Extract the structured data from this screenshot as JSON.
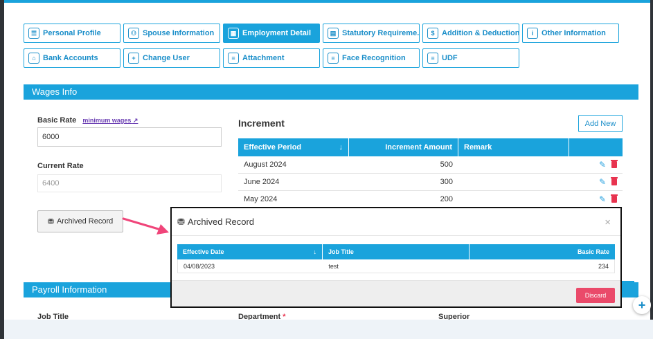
{
  "tabs": [
    {
      "label": "Personal Profile",
      "icon": "profile-icon",
      "active": false
    },
    {
      "label": "Spouse Information",
      "icon": "spouse-icon",
      "active": false
    },
    {
      "label": "Employment Detail",
      "icon": "employment-icon",
      "active": true
    },
    {
      "label": "Statutory Requireme...",
      "icon": "statutory-icon",
      "active": false
    },
    {
      "label": "Addition & Deduction",
      "icon": "addition-icon",
      "active": false
    },
    {
      "label": "Other Information",
      "icon": "other-info-icon",
      "active": false
    },
    {
      "label": "Bank Accounts",
      "icon": "bank-icon",
      "active": false
    },
    {
      "label": "Change User",
      "icon": "user-icon",
      "active": false
    },
    {
      "label": "Attachment",
      "icon": "attachment-icon",
      "active": false
    },
    {
      "label": "Face Recognition",
      "icon": "face-icon",
      "active": false
    },
    {
      "label": "UDF",
      "icon": "udf-icon",
      "active": false
    }
  ],
  "wages": {
    "title": "Wages Info",
    "basic_rate_label": "Basic Rate",
    "minimum_wages_link": "minimum wages",
    "basic_rate_value": "6000",
    "current_rate_label": "Current Rate",
    "current_rate_value": "6400",
    "archived_button": "Archived Record"
  },
  "increment": {
    "title": "Increment",
    "add_new": "Add New",
    "columns": [
      "Effective Period",
      "Increment Amount",
      "Remark",
      ""
    ],
    "rows": [
      {
        "period": "August 2024",
        "amount": "500",
        "remark": ""
      },
      {
        "period": "June 2024",
        "amount": "300",
        "remark": ""
      },
      {
        "period": "May 2024",
        "amount": "200",
        "remark": ""
      }
    ]
  },
  "payroll": {
    "title": "Payroll Information",
    "job_title_label": "Job Title",
    "department_label": "Department",
    "required_mark": "*",
    "superior_label": "Superior"
  },
  "modal": {
    "title": "Archived Record",
    "close": "×",
    "columns": [
      "Effective Date",
      "Job Title",
      "Basic Rate"
    ],
    "rows": [
      {
        "date": "04/08/2023",
        "job_title": "test",
        "basic_rate": "234"
      }
    ],
    "discard": "Discard"
  },
  "sort_icon": "↓",
  "colors": {
    "accent": "#1aa3dc",
    "danger": "#ea4a6a",
    "annotation_arrow": "#f0457a"
  }
}
